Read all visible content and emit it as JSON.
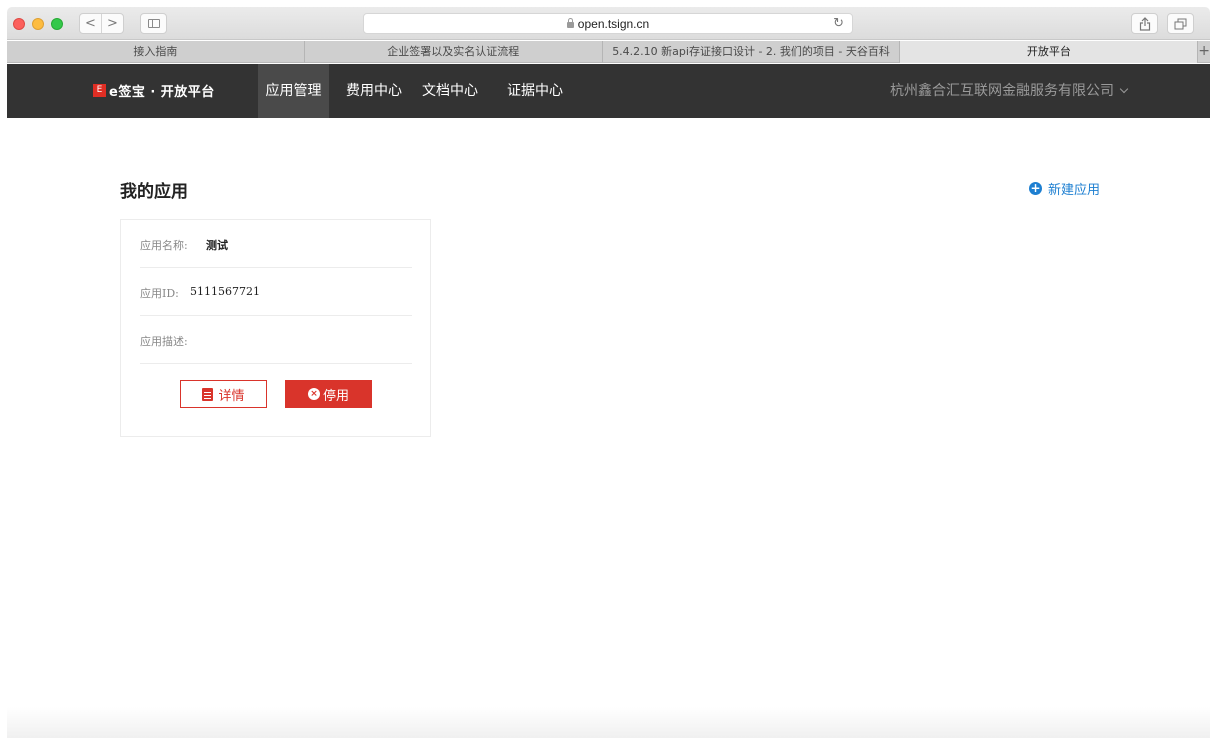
{
  "browser": {
    "url": "open.tsign.cn",
    "nav_back": "<",
    "nav_forward": ">",
    "reload_icon": "↻",
    "tabs": [
      {
        "label": "接入指南"
      },
      {
        "label": "企业签署以及实名认证流程"
      },
      {
        "label": "5.4.2.10 新api存证接口设计 - 2. 我们的项目 - 天谷百科"
      },
      {
        "label": "开放平台",
        "active": true
      }
    ],
    "new_tab": "+"
  },
  "site": {
    "logo_mark": "E",
    "logo_text": "e签宝 · 开放平台",
    "nav": [
      {
        "label": "应用管理",
        "active": true
      },
      {
        "label": "费用中心"
      },
      {
        "label": "文档中心"
      },
      {
        "label": "证据中心"
      }
    ],
    "company": "杭州鑫合汇互联网金融服务有限公司"
  },
  "main": {
    "title": "我的应用",
    "new_app_icon": "+",
    "new_app_label": "新建应用",
    "card": {
      "name_label": "应用名称:",
      "name_value": "测试",
      "id_label": "应用ID:",
      "id_value": "5111567721",
      "desc_label": "应用描述:",
      "desc_value": "",
      "detail_label": "详情",
      "stop_icon": "×",
      "stop_label": "停用"
    }
  },
  "colors": {
    "accent_red": "#d9342b",
    "link_blue": "#1d7fd1",
    "nav_bg": "#333333"
  },
  "icons": [
    "lock-icon",
    "reload-icon",
    "share-icon",
    "tabs-icon",
    "sidebar-icon",
    "chevron-down-icon",
    "plus-circle-icon",
    "document-icon",
    "x-circle-icon"
  ]
}
